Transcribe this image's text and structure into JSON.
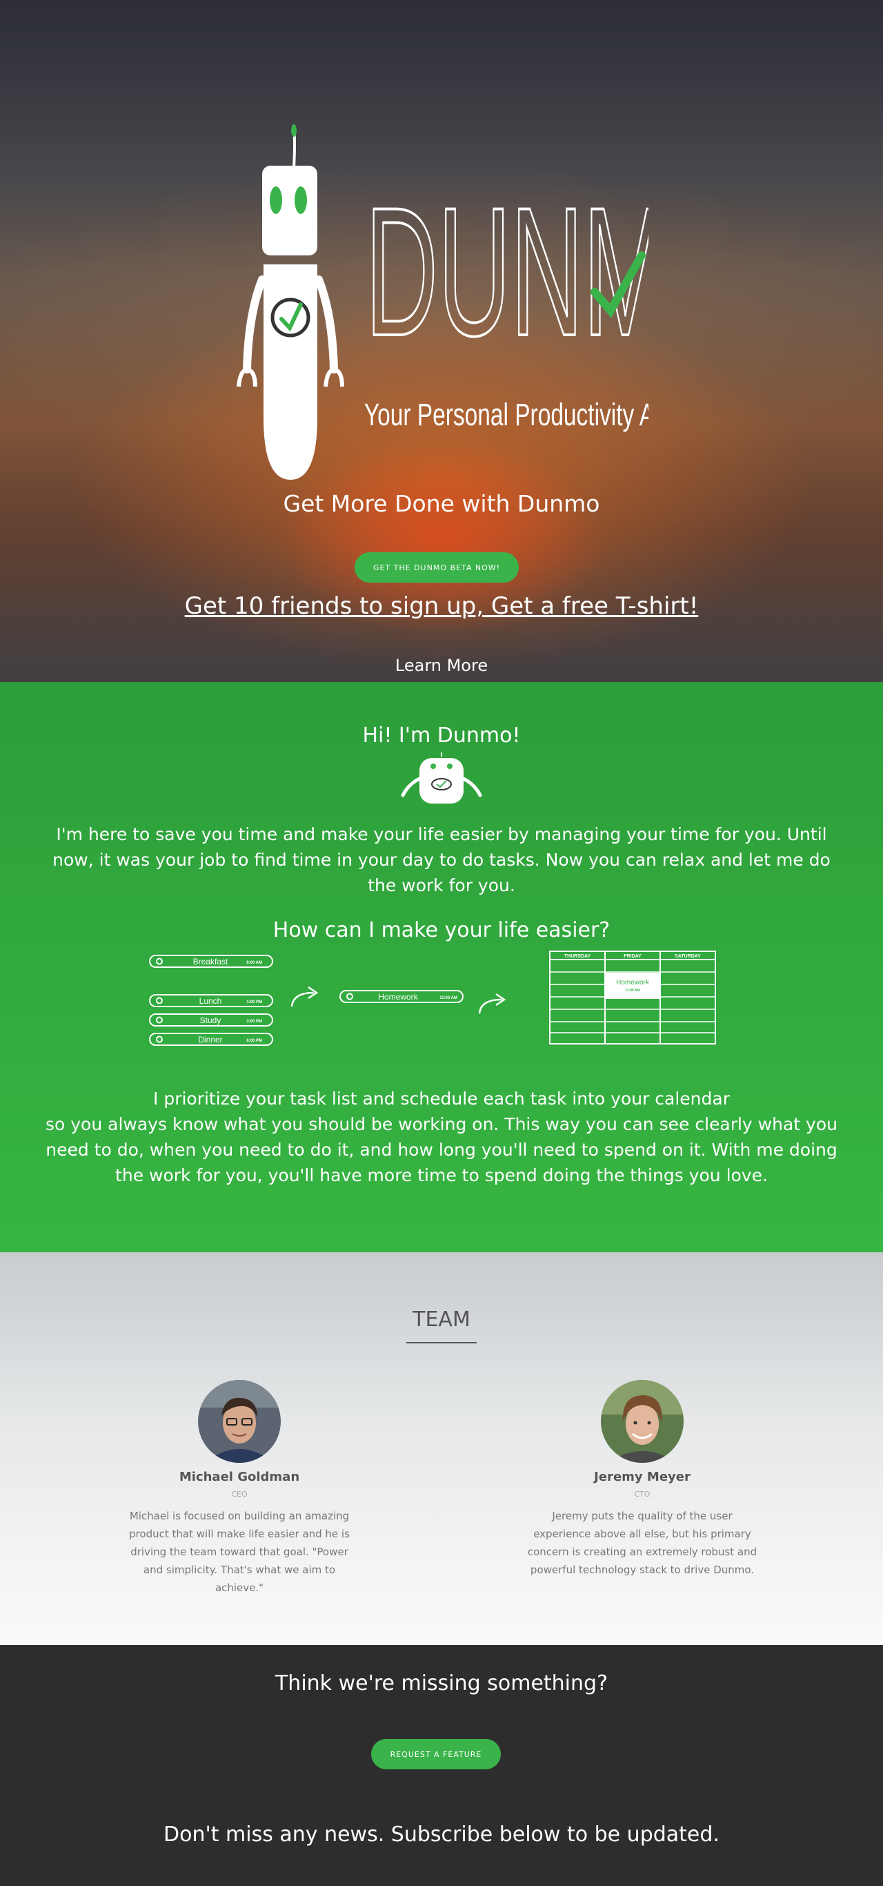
{
  "hero": {
    "brand": "DUNMO",
    "tagline": "Your Personal Productivity Assistant",
    "headline": "Get More Done with Dunmo",
    "beta_button": "GET THE DUNMO BETA NOW!",
    "referral_link": "Get 10 friends to sign up, Get a free T-shirt!",
    "learn_more": "Learn More",
    "accent": "#3ab34a"
  },
  "about": {
    "greeting": "Hi! I'm Dunmo!",
    "intro": "I'm here to save you time and make your life easier by managing your time for you. Until now, it was your job to find time in your day to do tasks. Now you can relax and let me do the work for you.",
    "question": "How can I make your life easier?",
    "tasks": [
      {
        "label": "Breakfast",
        "time": "9:00 AM"
      },
      {
        "label": "Lunch",
        "time": "1:00 PM"
      },
      {
        "label": "Study",
        "time": "3:00 PM"
      },
      {
        "label": "Dinner",
        "time": "6:00 PM"
      }
    ],
    "new_task": {
      "label": "Homework",
      "time": "11:00 AM"
    },
    "calendar": {
      "days": [
        "THURSDAY",
        "FRIDAY",
        "SATURDAY"
      ],
      "event": "Homework",
      "event_time": "11:00 AM"
    },
    "description_line1": "I prioritize your task list and schedule each task into your calendar",
    "description_rest": "so you always know what you should be working on. This way you can see clearly what you need to do, when you need to do it, and how long you'll need to spend on it. With me doing the work for you, you'll have more time to spend doing the things you love."
  },
  "team": {
    "heading": "TEAM",
    "members": [
      {
        "name": "Michael Goldman",
        "role": "CEO",
        "bio": "Michael is focused on building an amazing product that will make life easier and he is driving the team toward that goal. \"Power and simplicity. That's what we aim to achieve.\""
      },
      {
        "name": "Jeremy Meyer",
        "role": "CTO",
        "bio": "Jeremy puts the quality of the user experience above all else, but his primary concern is creating an extremely robust and powerful technology stack to drive Dunmo."
      }
    ]
  },
  "footer": {
    "missing": "Think we're missing something?",
    "request_button": "REQUEST A FEATURE",
    "news": "Don't miss any news.  Subscribe below to be updated."
  }
}
